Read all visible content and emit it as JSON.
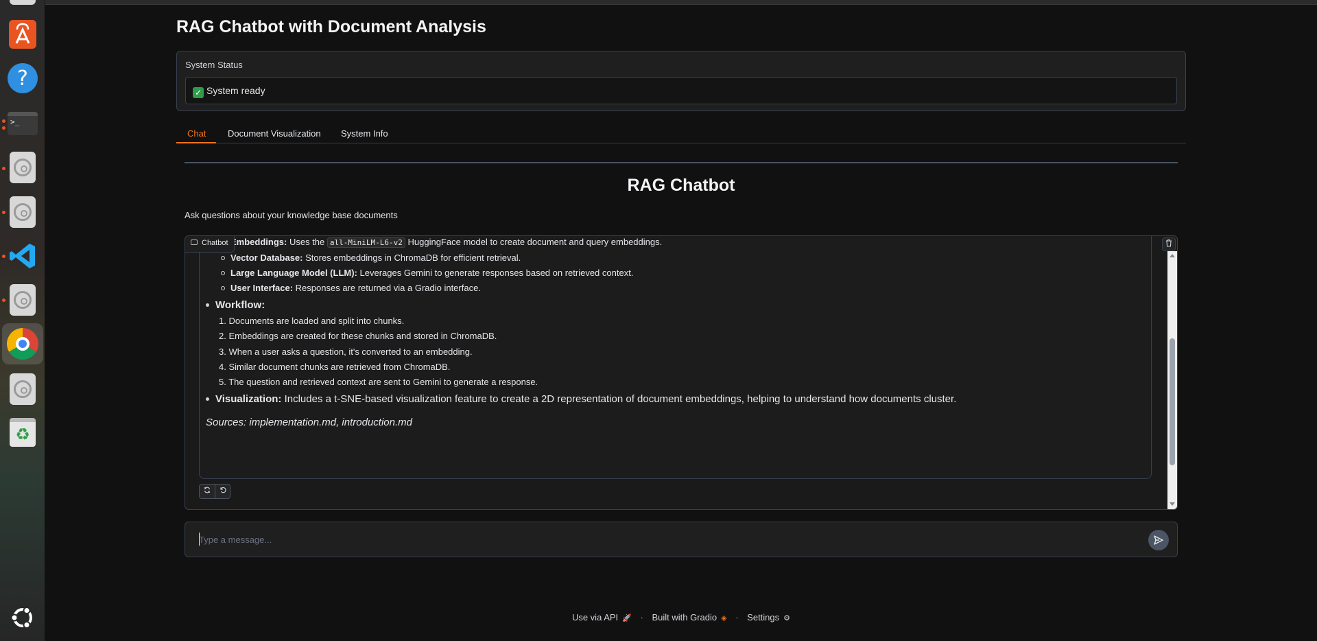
{
  "app": {
    "title": "RAG Chatbot with Document Analysis"
  },
  "status": {
    "label": "System Status",
    "value": "System ready",
    "icon": "check-mark-icon"
  },
  "tabs": [
    {
      "label": "Chat",
      "active": true
    },
    {
      "label": "Document Visualization",
      "active": false
    },
    {
      "label": "System Info",
      "active": false
    }
  ],
  "chat": {
    "heading": "RAG Chatbot",
    "subtitle": "Ask questions about your knowledge base documents",
    "chatbot_label": "Chatbot",
    "message": {
      "embeddings_label": "Embeddings:",
      "embeddings_pre": "Uses the",
      "embeddings_code": "all-MiniLM-L6-v2",
      "embeddings_post": "HuggingFace model to create document and query embeddings.",
      "components": [
        {
          "label": "Vector Database:",
          "text": "Stores embeddings in ChromaDB for efficient retrieval."
        },
        {
          "label": "Large Language Model (LLM):",
          "text": "Leverages Gemini to generate responses based on retrieved context."
        },
        {
          "label": "User Interface:",
          "text": "Responses are returned via a Gradio interface."
        }
      ],
      "workflow_label": "Workflow:",
      "workflow_steps": [
        "Documents are loaded and split into chunks.",
        "Embeddings are created for these chunks and stored in ChromaDB.",
        "When a user asks a question, it's converted to an embedding.",
        "Similar document chunks are retrieved from ChromaDB.",
        "The question and retrieved context are sent to Gemini to generate a response."
      ],
      "visualization_label": "Visualization:",
      "visualization_text": "Includes a t-SNE-based visualization feature to create a 2D representation of document embeddings, helping to understand how documents cluster.",
      "sources": "Sources: implementation.md, introduction.md"
    },
    "input_placeholder": "Type a message..."
  },
  "footer": {
    "api": "Use via API",
    "built": "Built with Gradio",
    "settings": "Settings"
  },
  "colors": {
    "accent": "#f97316",
    "background": "#111111",
    "panel": "#1f1f1f",
    "border": "#374151"
  },
  "dock": {
    "items": [
      "app-center-icon",
      "help-icon",
      "terminal-icon",
      "disk-icon",
      "disk-icon",
      "vscode-icon",
      "disk-icon",
      "chrome-icon",
      "disk-icon",
      "trash-icon",
      "ubuntu-logo-icon"
    ]
  }
}
